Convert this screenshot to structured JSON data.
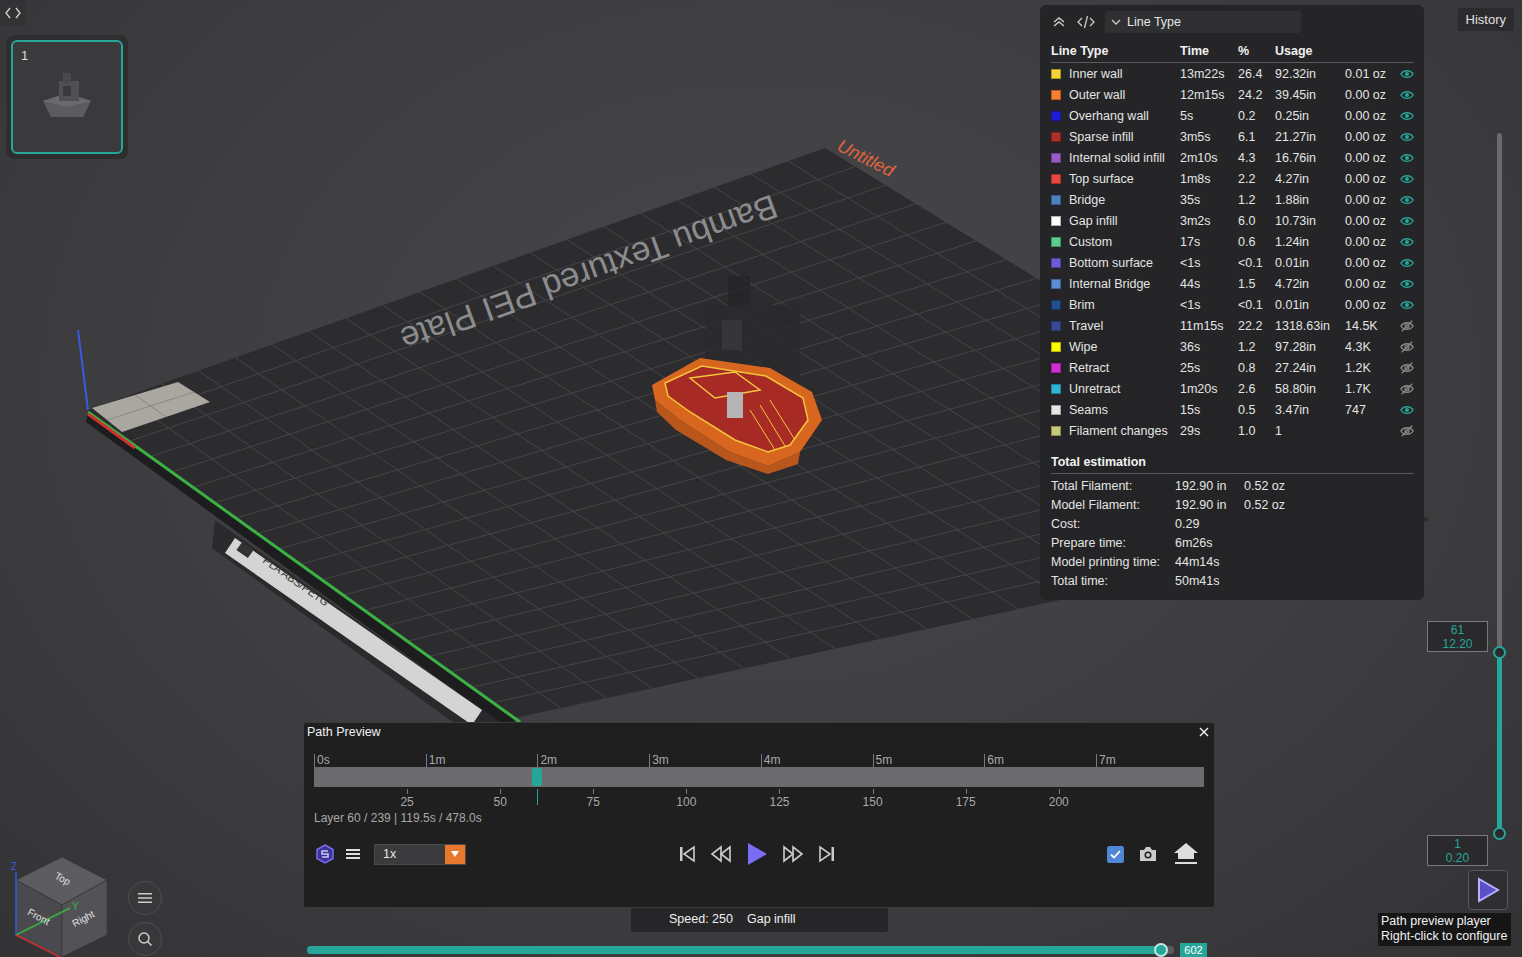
{
  "top_bar": {
    "history_button": "History"
  },
  "plates": [
    {
      "label": "1",
      "selected": true
    }
  ],
  "scene": {
    "plate_name": "Bambu Textured PEI Plate",
    "project_title": "Untitled",
    "plate_tag": "PLA ABS/PETG"
  },
  "legend": {
    "view": "Line Type",
    "columns": [
      "Line Type",
      "Time",
      "%",
      "Usage"
    ],
    "rows": [
      {
        "name": "Inner wall",
        "time": "13m22s",
        "percent": "26.4",
        "length": "92.32in",
        "amount": "0.01 oz",
        "visible": true,
        "color": "#f2d43a"
      },
      {
        "name": "Outer wall",
        "time": "12m15s",
        "percent": "24.2",
        "length": "39.45in",
        "amount": "0.00 oz",
        "visible": true,
        "color": "#ff7f32"
      },
      {
        "name": "Overhang wall",
        "time": "5s",
        "percent": "0.2",
        "length": "0.25in",
        "amount": "0.00 oz",
        "visible": true,
        "color": "#1d1dd6"
      },
      {
        "name": "Sparse infill",
        "time": "3m5s",
        "percent": "6.1",
        "length": "21.27in",
        "amount": "0.00 oz",
        "visible": true,
        "color": "#b02f28"
      },
      {
        "name": "Internal solid infill",
        "time": "2m10s",
        "percent": "4.3",
        "length": "16.76in",
        "amount": "0.00 oz",
        "visible": true,
        "color": "#9b59c6"
      },
      {
        "name": "Top surface",
        "time": "1m8s",
        "percent": "2.2",
        "length": "4.27in",
        "amount": "0.00 oz",
        "visible": true,
        "color": "#e8453c"
      },
      {
        "name": "Bridge",
        "time": "35s",
        "percent": "1.2",
        "length": "1.88in",
        "amount": "0.00 oz",
        "visible": true,
        "color": "#4f7fbf"
      },
      {
        "name": "Gap infill",
        "time": "3m2s",
        "percent": "6.0",
        "length": "10.73in",
        "amount": "0.00 oz",
        "visible": true,
        "color": "#ffffff"
      },
      {
        "name": "Custom",
        "time": "17s",
        "percent": "0.6",
        "length": "1.24in",
        "amount": "0.00 oz",
        "visible": true,
        "color": "#5bd08e"
      },
      {
        "name": "Bottom surface",
        "time": "<1s",
        "percent": "<0.1",
        "length": "0.01in",
        "amount": "0.00 oz",
        "visible": true,
        "color": "#6a5fd8"
      },
      {
        "name": "Internal Bridge",
        "time": "44s",
        "percent": "1.5",
        "length": "4.72in",
        "amount": "0.00 oz",
        "visible": true,
        "color": "#5a8ed0"
      },
      {
        "name": "Brim",
        "time": "<1s",
        "percent": "<0.1",
        "length": "0.01in",
        "amount": "0.00 oz",
        "visible": true,
        "color": "#1f4f8f"
      },
      {
        "name": "Travel",
        "time": "11m15s",
        "percent": "22.2",
        "length": "1318.63in",
        "amount": "14.5K",
        "visible": false,
        "color": "#3a4898"
      },
      {
        "name": "Wipe",
        "time": "36s",
        "percent": "1.2",
        "length": "97.28in",
        "amount": "4.3K",
        "visible": false,
        "color": "#ffff00"
      },
      {
        "name": "Retract",
        "time": "25s",
        "percent": "0.8",
        "length": "27.24in",
        "amount": "1.2K",
        "visible": false,
        "color": "#d62ad6"
      },
      {
        "name": "Unretract",
        "time": "1m20s",
        "percent": "2.6",
        "length": "58.80in",
        "amount": "1.7K",
        "visible": false,
        "color": "#2fb6d6"
      },
      {
        "name": "Seams",
        "time": "15s",
        "percent": "0.5",
        "length": "3.47in",
        "amount": "747",
        "visible": true,
        "color": "#e6e6e6"
      },
      {
        "name": "Filament changes",
        "time": "29s",
        "percent": "1.0",
        "length": "1",
        "amount": "",
        "visible": false,
        "color": "#c8c878"
      }
    ],
    "totals_title": "Total estimation",
    "totals": [
      {
        "label": "Total Filament:",
        "value": "192.90 in",
        "extra": "0.52 oz"
      },
      {
        "label": "Model Filament:",
        "value": "192.90 in",
        "extra": "0.52 oz"
      },
      {
        "label": "Cost:",
        "value": "0.29",
        "extra": ""
      },
      {
        "label": "Prepare time:",
        "value": "6m26s",
        "extra": ""
      },
      {
        "label": "Model printing time:",
        "value": "44m14s",
        "extra": ""
      },
      {
        "label": "Total time:",
        "value": "50m41s",
        "extra": ""
      }
    ]
  },
  "layer_slider": {
    "upper": {
      "layer": "61",
      "height": "12.20",
      "level": 0.258
    },
    "lower": {
      "layer": "1",
      "height": "0.20",
      "level": 0
    }
  },
  "path_preview": {
    "title": "Path Preview",
    "speed": "1x",
    "follow_camera_checked": true,
    "level": 0.25,
    "status": "Layer 60 / 239 | 119.5s / 478.0s",
    "total_seconds": 478,
    "total_layers": 239,
    "time_ticks": [
      {
        "label": "0s",
        "seconds": 0
      },
      {
        "label": "1m",
        "seconds": 60
      },
      {
        "label": "2m",
        "seconds": 120
      },
      {
        "label": "3m",
        "seconds": 180
      },
      {
        "label": "4m",
        "seconds": 240
      },
      {
        "label": "5m",
        "seconds": 300
      },
      {
        "label": "6m",
        "seconds": 360
      },
      {
        "label": "7m",
        "seconds": 420
      }
    ],
    "layer_ticks": [
      {
        "label": "25",
        "layer": 25
      },
      {
        "label": "50",
        "layer": 50
      },
      {
        "label": "75",
        "layer": 75
      },
      {
        "label": "100",
        "layer": 100
      },
      {
        "label": "125",
        "layer": 125
      },
      {
        "label": "150",
        "layer": 150
      },
      {
        "label": "175",
        "layer": 175
      },
      {
        "label": "200",
        "layer": 200
      }
    ]
  },
  "hover_info": {
    "speed": "Speed: 250",
    "line_type": "Gap infill"
  },
  "move_slider": {
    "value": "602",
    "level": 0.985
  },
  "player_button": {
    "tooltip": [
      "Path preview player",
      "Right-click to configure"
    ]
  },
  "view_cube": {
    "faces": {
      "top": "Top",
      "front": "Front",
      "right": "Right"
    },
    "axes": {
      "z": "Z",
      "y": "Y"
    }
  }
}
